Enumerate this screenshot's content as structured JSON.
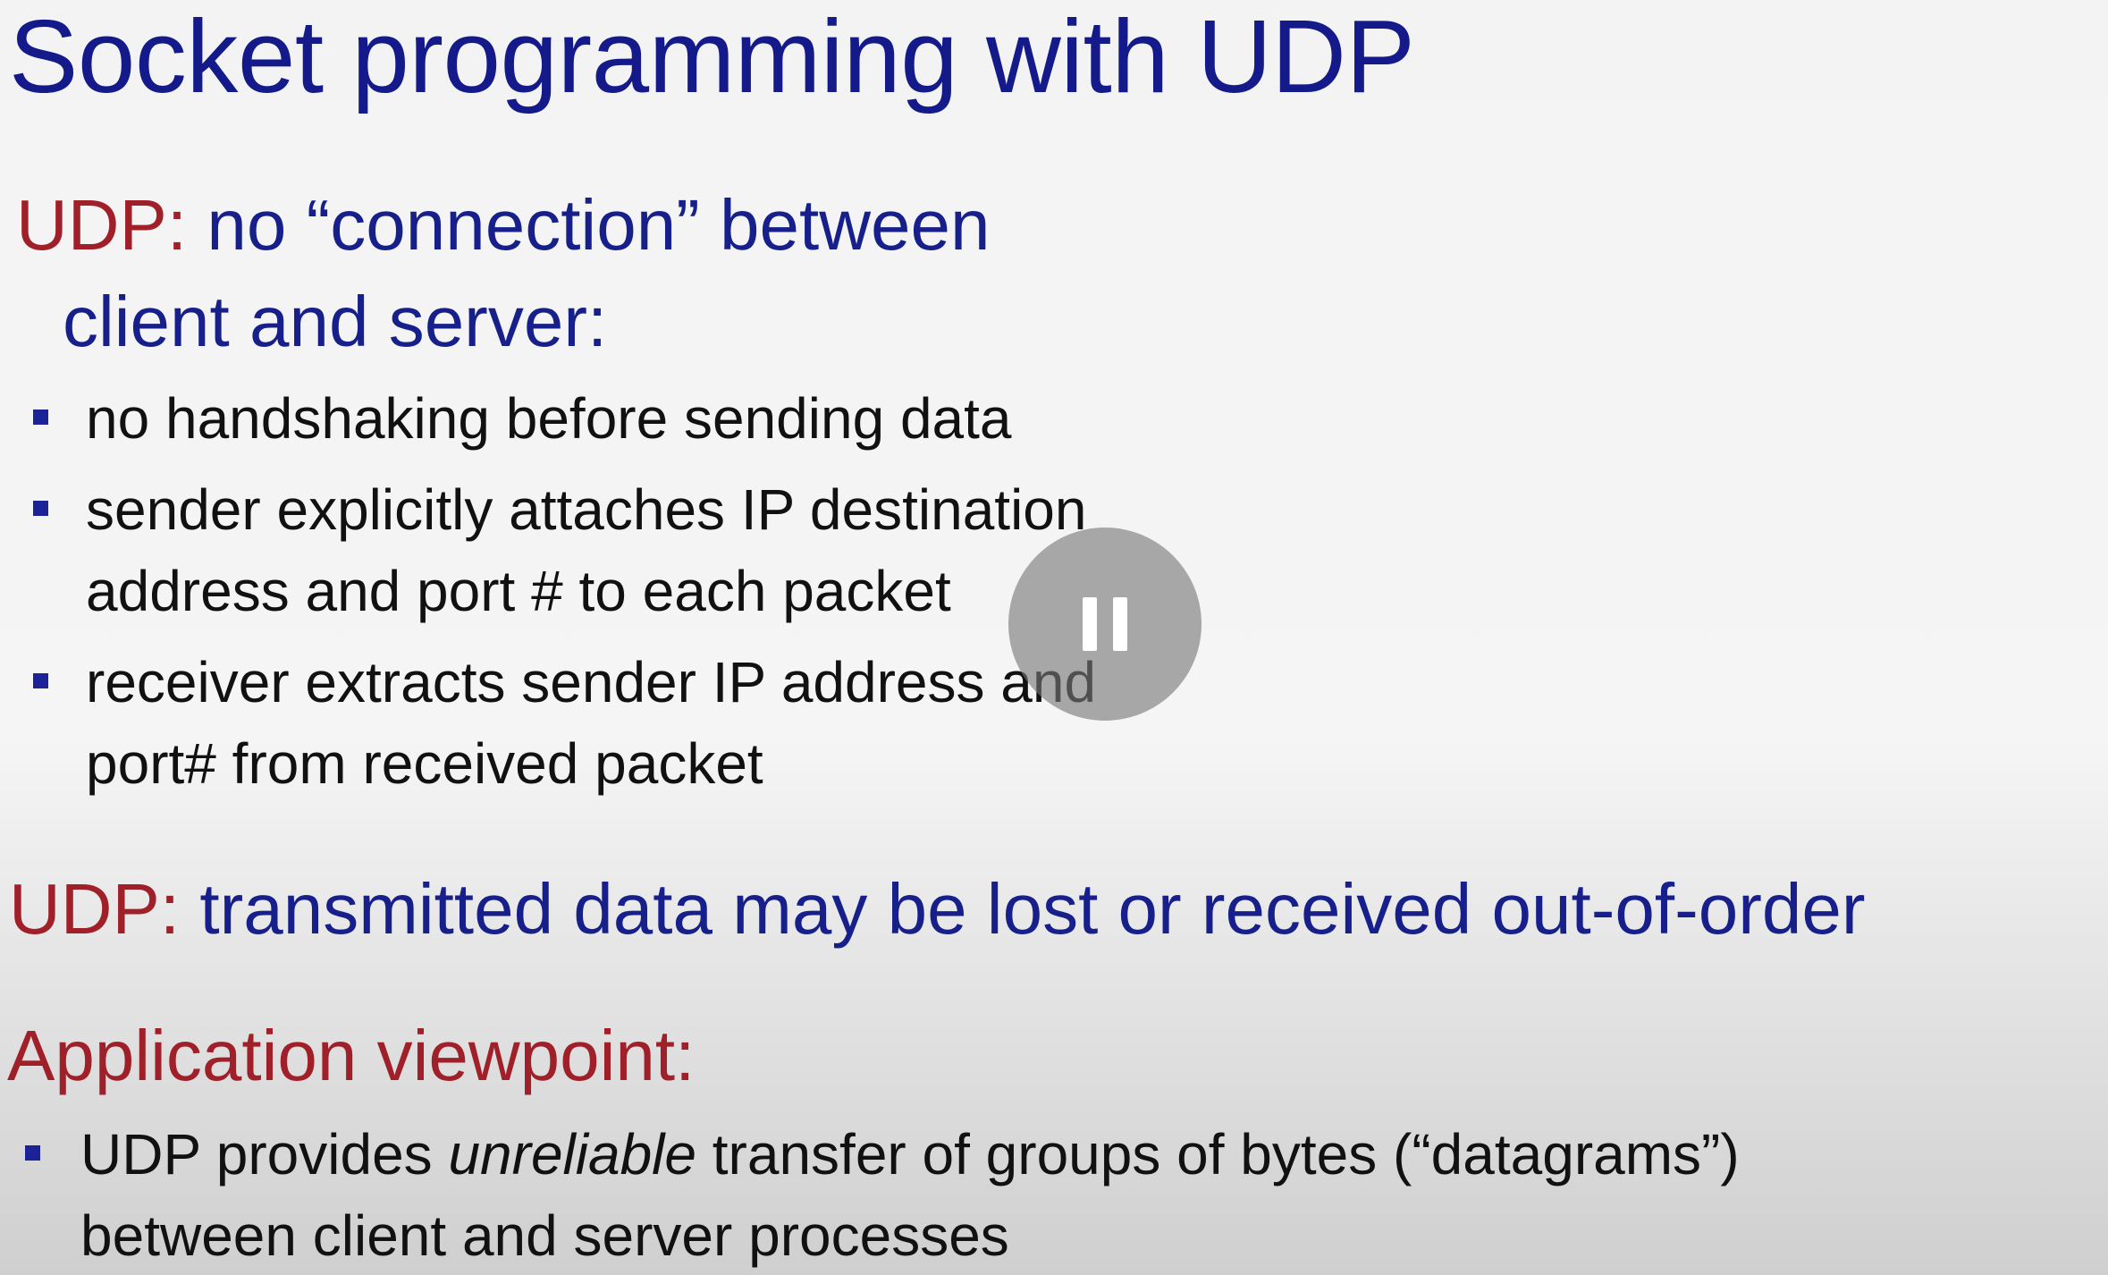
{
  "slide": {
    "title": "Socket programming with UDP",
    "section1": {
      "prefix": "UDP:",
      "line1_rest": "no “connection” between",
      "line2": "client and server:"
    },
    "bullets1": [
      {
        "lines": [
          "no handshaking before sending data"
        ]
      },
      {
        "lines": [
          "sender explicitly attaches IP destination",
          "address and port # to each packet"
        ]
      },
      {
        "lines": [
          "receiver extracts sender IP address and",
          "port# from received packet"
        ]
      }
    ],
    "section2": {
      "prefix": "UDP:",
      "rest": "transmitted data may be lost or received out-of-order"
    },
    "section3": {
      "heading": "Application viewpoint:"
    },
    "bullets2": {
      "line1_part1": "UDP provides ",
      "line1_italic": "unreliable",
      "line1_part2": " transfer  of groups of bytes (“datagrams”)",
      "line2": "between client and server processes"
    }
  },
  "player": {
    "overlay_icon": "pause-icon",
    "overlay_color": "#7b7b7b"
  }
}
